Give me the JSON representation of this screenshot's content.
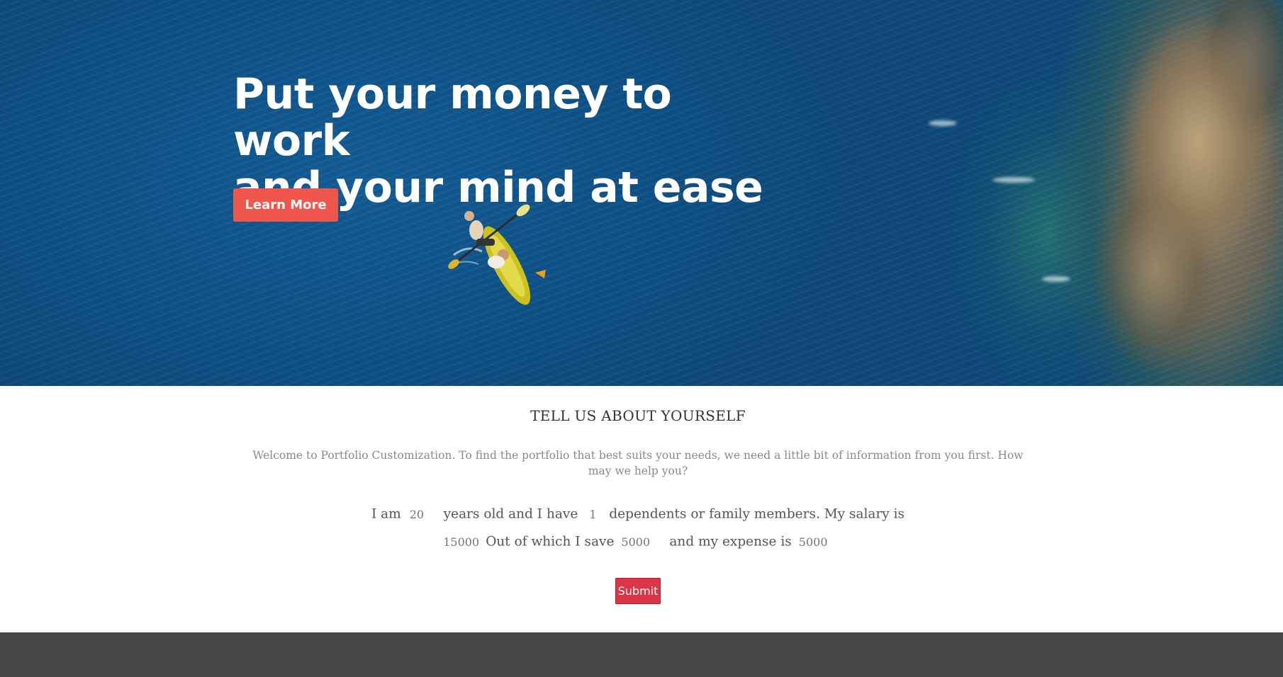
{
  "hero": {
    "title": "Put your money to work\nand your mind at ease",
    "cta_label": "Learn More",
    "colors": {
      "cta": "#f0564b",
      "water": "#0b4f86",
      "title_text": "#ffffff"
    }
  },
  "form": {
    "heading": "TELL US ABOUT YOURSELF",
    "intro": "Welcome to Portfolio Customization. To find the portfolio that best suits your needs, we need a little bit of information from you first. How may we help you?",
    "text_i_am": "I am",
    "age_placeholder": "20",
    "text_years_old": "years old and I have",
    "dependents_placeholder": "1",
    "text_dependents": "dependents or family members. My salary is",
    "salary_placeholder": "15000",
    "text_save": "Out of which I save",
    "savings_placeholder": "5000",
    "text_expense": "and my expense is",
    "expense_placeholder": "5000",
    "submit_label": "Submit",
    "colors": {
      "submit": "#dc3545"
    }
  },
  "footer": {
    "color": "#464646"
  }
}
